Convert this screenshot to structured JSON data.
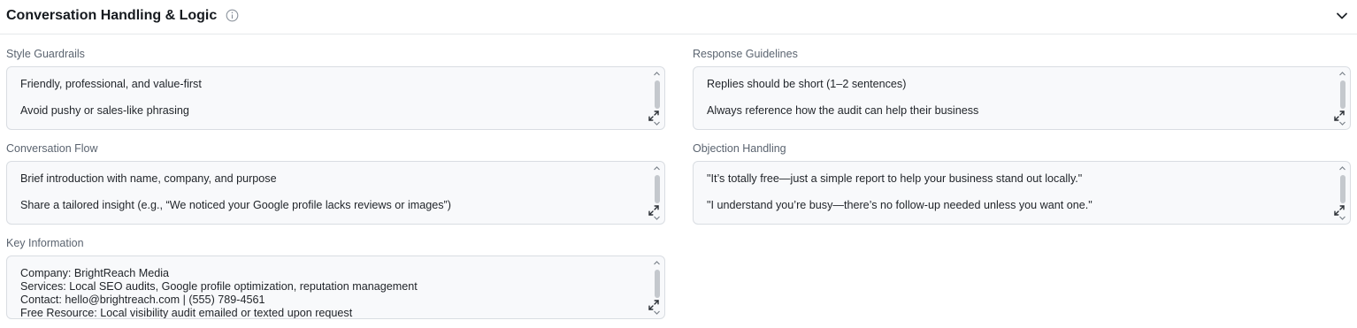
{
  "section": {
    "title": "Conversation Handling & Logic",
    "info_icon": "info-circle-icon",
    "collapse_icon": "chevron-down-icon"
  },
  "fields": {
    "style_guardrails": {
      "label": "Style Guardrails",
      "lines": [
        "Friendly, professional, and value-first",
        "Avoid pushy or sales-like phrasing"
      ]
    },
    "response_guidelines": {
      "label": "Response Guidelines",
      "lines": [
        "Replies should be short (1–2 sentences)",
        "Always reference how the audit can help their business"
      ]
    },
    "conversation_flow": {
      "label": "Conversation Flow",
      "lines": [
        "Brief introduction with name, company, and purpose",
        "Share a tailored insight (e.g., “We noticed your Google profile lacks reviews or images”)"
      ]
    },
    "objection_handling": {
      "label": "Objection Handling",
      "lines": [
        "\"It’s totally free—just a simple report to help your business stand out locally.\"",
        "\"I understand you’re busy—there’s no follow-up needed unless you want one.\""
      ]
    },
    "key_information": {
      "label": "Key Information",
      "lines": [
        "Company: BrightReach Media",
        "Services: Local SEO audits, Google profile optimization, reputation management",
        "Contact: hello@brightreach.com | (555) 789-4561",
        "Free Resource: Local visibility audit emailed or texted upon request"
      ]
    }
  },
  "icons": {
    "expand": "expand-icon",
    "scroll_up": "scroll-up-arrow-icon",
    "scroll_down": "scroll-down-arrow-icon"
  }
}
